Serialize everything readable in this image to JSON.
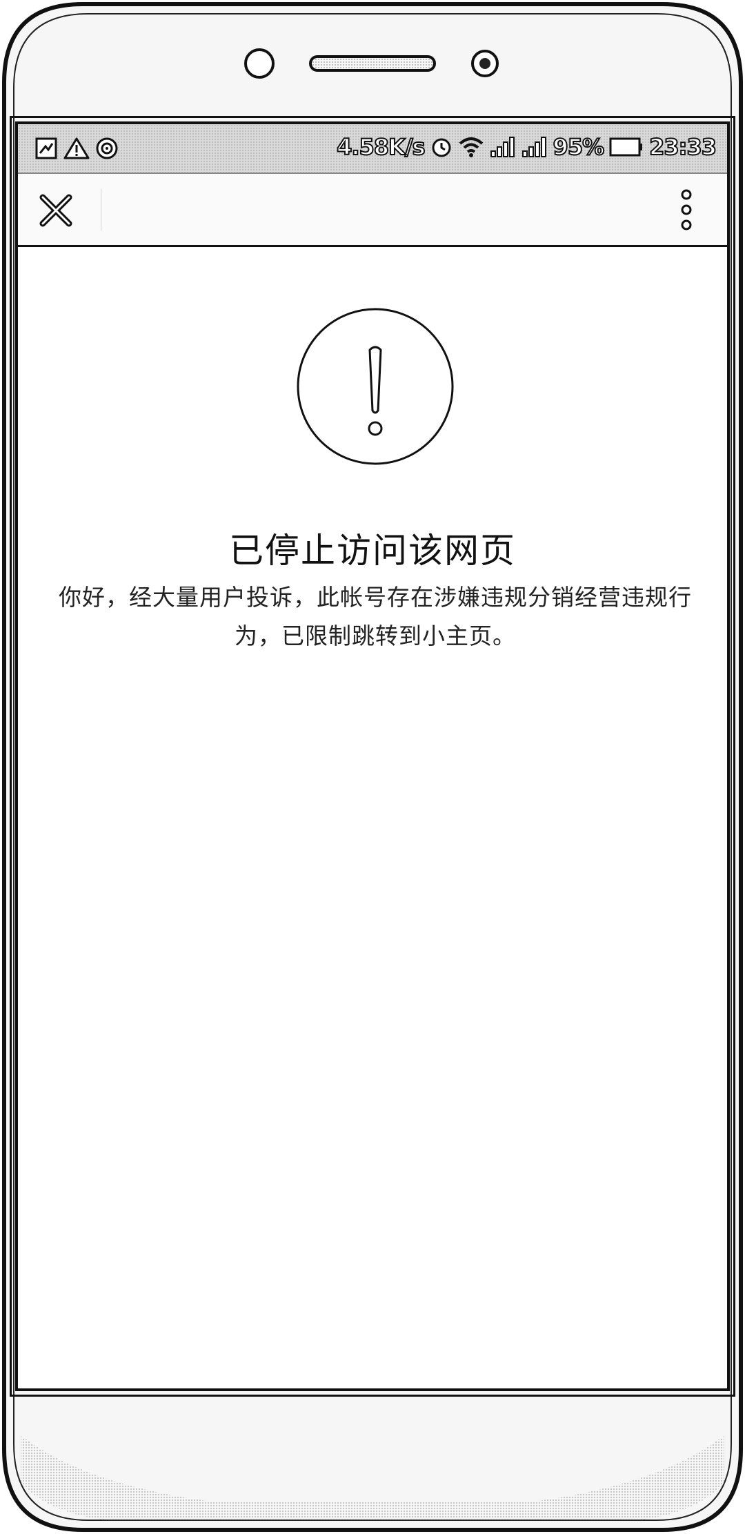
{
  "status_bar": {
    "network_speed": "4.58K/s",
    "battery_percent": "95%",
    "time": "23:33",
    "left_icons": [
      "image-notification-icon",
      "warning-notification-icon",
      "app-notification-icon"
    ],
    "right_icons": [
      "alarm-icon",
      "wifi-icon",
      "signal-icon",
      "signal-icon",
      "battery-icon"
    ]
  },
  "nav_bar": {
    "close_icon": "close-icon",
    "more_icon": "more-vertical-icon"
  },
  "content": {
    "icon": "exclamation-circle-icon",
    "title": "已停止访问该网页",
    "description": "你好，经大量用户投诉，此帐号存在涉嫌违规分销经营违规行为，已限制跳转到小主页。"
  }
}
